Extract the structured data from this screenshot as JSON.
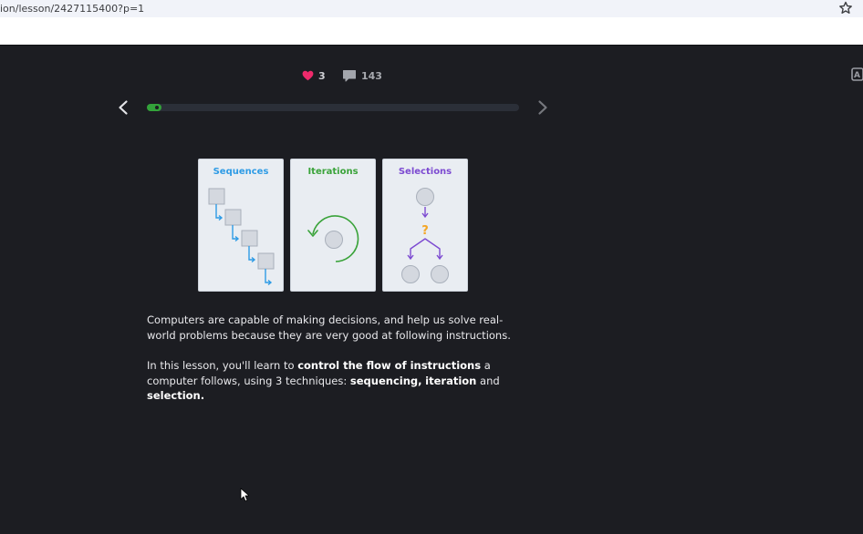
{
  "browser": {
    "url_text": "ion/lesson/2427115400?p=1"
  },
  "stats": {
    "likes": "3",
    "comments": "143"
  },
  "progress": {
    "fraction": 0.04
  },
  "cards": [
    {
      "title": "Sequences",
      "color": "#2e9be5"
    },
    {
      "title": "Iterations",
      "color": "#3aa33a"
    },
    {
      "title": "Selections",
      "color": "#7c4ad1"
    }
  ],
  "selection_mark": "?",
  "lesson": {
    "p1": "Computers are capable of making decisions, and help us solve real-world problems because they are very good at following instructions.",
    "p2_a": "In this lesson, you'll learn to ",
    "p2_b": "control the flow of instructions",
    "p2_c": " a computer follows, using 3 techniques: ",
    "p2_d": "sequencing,",
    "p2_e": " ",
    "p2_f": "iteration",
    "p2_g": " and ",
    "p2_h": "selection."
  },
  "colors": {
    "background": "#1c1d22",
    "heart": "#ee2a6b",
    "accent_green": "#33a33a",
    "accent_orange": "#f4a625"
  }
}
